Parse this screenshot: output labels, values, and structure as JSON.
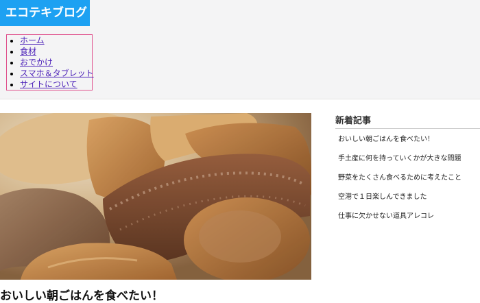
{
  "site": {
    "logo": "エコテキブログ"
  },
  "nav": {
    "items": [
      {
        "label": "ホーム"
      },
      {
        "label": "食材"
      },
      {
        "label": "おでかけ"
      },
      {
        "label": "スマホ＆タブレット"
      },
      {
        "label": "サイトについて"
      }
    ]
  },
  "post": {
    "title": "おいしい朝ごはんを食べたい！"
  },
  "sidebar": {
    "title": "新着記事",
    "items": [
      {
        "label": "おいしい朝ごはんを食べたい！"
      },
      {
        "label": "手土産に何を持っていくかが大きな問題"
      },
      {
        "label": "野菜をたくさん食べるために考えたこと"
      },
      {
        "label": "空港で１日楽しんできました"
      },
      {
        "label": "仕事に欠かせない道具アレコレ"
      }
    ]
  },
  "colors": {
    "logo_bg": "#1da1f2",
    "header_bg": "#f4f4f5",
    "nav_border": "#e0508c",
    "link": "#4a1fb8"
  }
}
